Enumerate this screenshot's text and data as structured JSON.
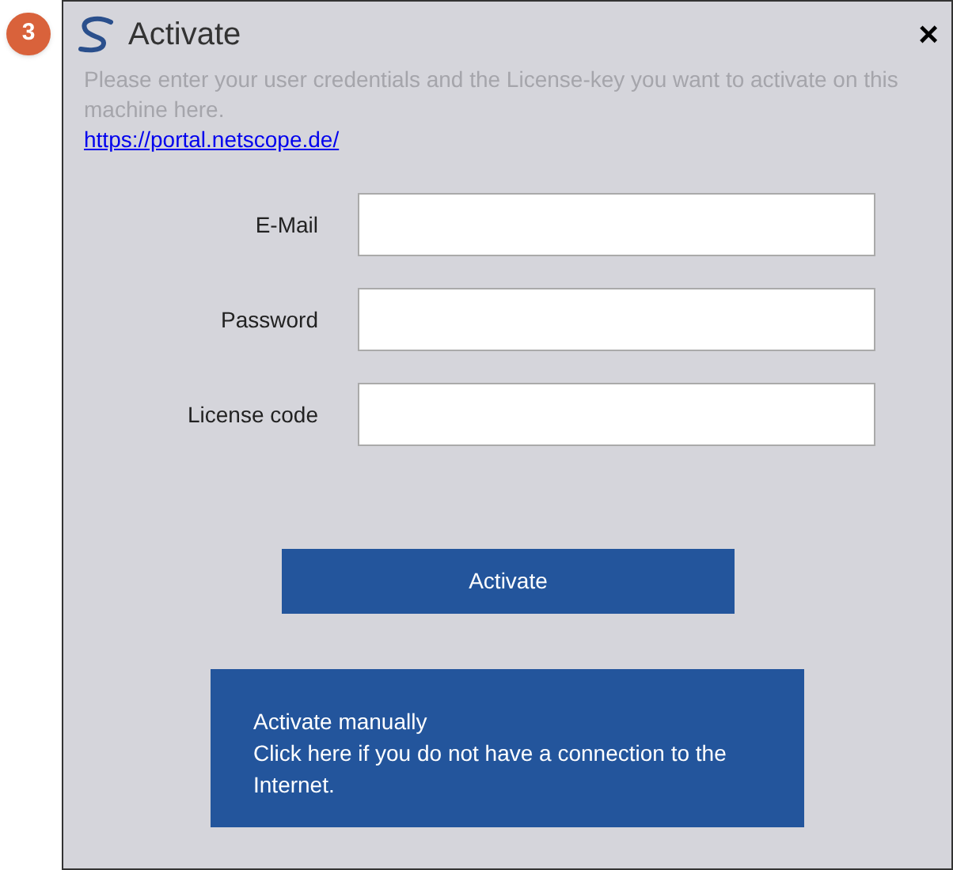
{
  "step_badge": "3",
  "window": {
    "title": "Activate",
    "close": "×"
  },
  "intro": "Please enter your user credentials and the License-key you want to activate on this machine here.",
  "link": "https://portal.netscope.de/",
  "fields": [
    {
      "label": "E-Mail"
    },
    {
      "label": "Password"
    },
    {
      "label": "License code"
    }
  ],
  "activate_button": "Activate",
  "manual_button": {
    "title": "Activate manually",
    "text": "Click here if you do not have a connection to the Internet."
  }
}
